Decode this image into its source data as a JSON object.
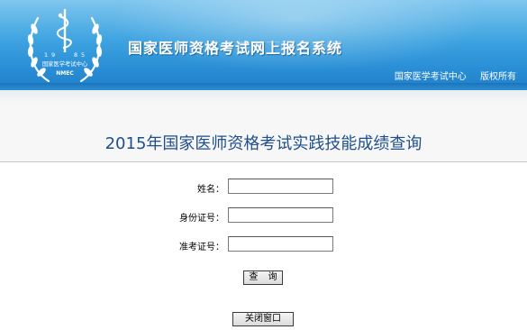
{
  "header": {
    "site_title": "国家医师资格考试网上报名系统",
    "logo": {
      "year_digits": [
        "1",
        "9",
        "8",
        "5"
      ],
      "center_text": "国家医学考试中心",
      "abbr": "NMEC"
    },
    "right_links": [
      "国家医学考试中心",
      "版权所有"
    ]
  },
  "page_title": "2015年国家医师资格考试实践技能成绩查询",
  "form": {
    "name_label": "姓名：",
    "name_value": "",
    "id_label": "身份证号：",
    "id_value": "",
    "ticket_label": "准考证号：",
    "ticket_value": ""
  },
  "buttons": {
    "query": "查 询",
    "close": "关闭窗口"
  },
  "colors": {
    "header_blue": "#2a8fd6",
    "title_blue": "#1f4f8c"
  }
}
